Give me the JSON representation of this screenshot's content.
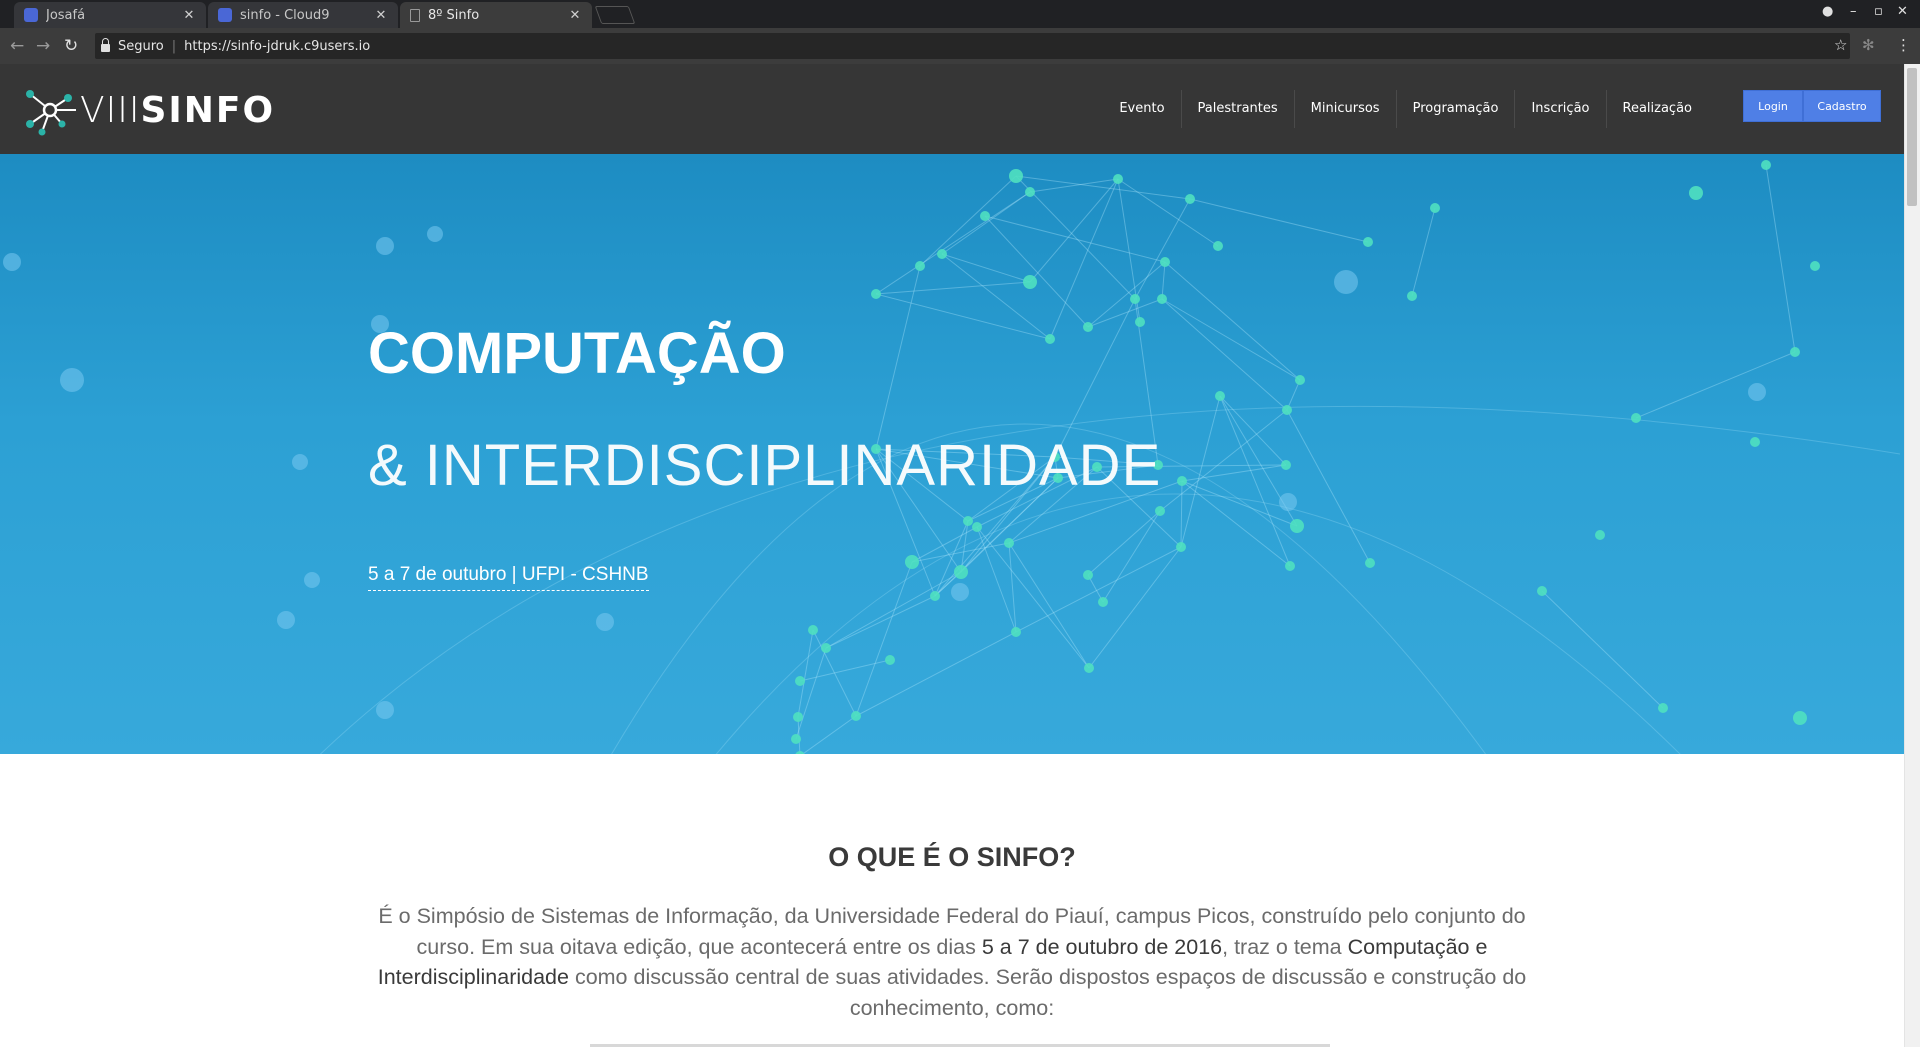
{
  "browser": {
    "tabs": [
      {
        "label": "Josafá",
        "icon": "cloud9-icon"
      },
      {
        "label": "sinfo - Cloud9",
        "icon": "cloud9-icon"
      },
      {
        "label": "8º Sinfo",
        "icon": "document-icon"
      }
    ],
    "secure_label": "Seguro",
    "url": "https://sinfo-jdruk.c9users.io"
  },
  "header": {
    "logo_roman": "VIII",
    "logo_brand": "SINFO",
    "nav": [
      "Evento",
      "Palestrantes",
      "Minicursos",
      "Programação",
      "Inscrição",
      "Realização"
    ],
    "login_label": "Login",
    "signup_label": "Cadastro",
    "colors": {
      "header_bg": "#363636",
      "button": "#4f7fe6",
      "logo_accent": "#2bb3a8"
    }
  },
  "hero": {
    "title": "COMPUTAÇÃO",
    "subtitle": "& INTERDISCIPLINARIDADE",
    "date_location": "5 a 7 de outubro | UFPI - CSHNB",
    "colors": {
      "bg_top": "#1d8cc2",
      "bg_bottom": "#37a9db",
      "node": "#4fe0c0"
    }
  },
  "about": {
    "title": "O QUE É O SINFO?",
    "text_1": "É o Simpósio de Sistemas de Informação, da Universidade Federal do Piauí, campus Picos, construído pelo conjunto do curso. Em sua oitava edição, que acontecerá entre os dias ",
    "text_bold_1": "5 a 7 de outubro de 2016",
    "text_2": ", traz o tema ",
    "text_bold_2": "Computação e Interdisciplinaridade",
    "text_3": " como discussão central de suas atividades. Serão dispostos espaços de discussão e construção do conhecimento, como:"
  }
}
